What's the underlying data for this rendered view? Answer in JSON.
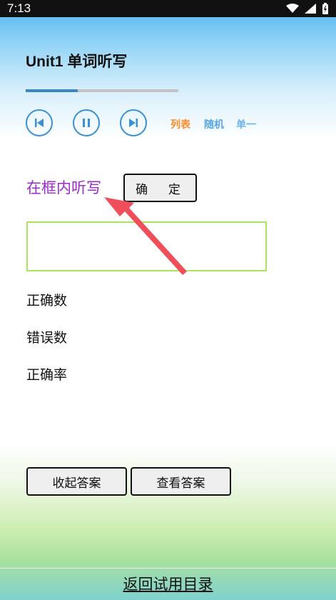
{
  "status_bar": {
    "time": "7:13"
  },
  "header": {
    "title": "Unit1 单词听写"
  },
  "player": {
    "progress": 0.34,
    "modes": {
      "list": "列表",
      "random": "随机",
      "single": "单一"
    },
    "colors": {
      "list": "#ff8a2a",
      "random": "#5aa6e6",
      "single": "#6db3ef"
    }
  },
  "dictation": {
    "prompt": "在框内听写",
    "confirm_label": "确  定",
    "input_value": ""
  },
  "stats": {
    "correct_count_label": "正确数",
    "wrong_count_label": "错误数",
    "accuracy_label": "正确率"
  },
  "actions": {
    "collapse_answers": "收起答案",
    "view_answers": "查看答案"
  },
  "footer": {
    "back_link": "返回试用目录"
  }
}
